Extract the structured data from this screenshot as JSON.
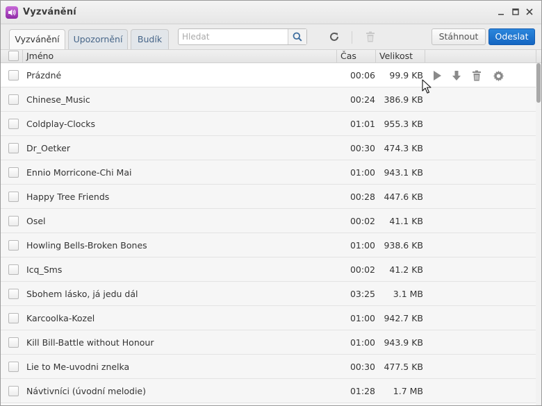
{
  "window": {
    "title": "Vyzvánění",
    "icon": "speaker-icon",
    "controls": [
      "minimize",
      "maximize",
      "close"
    ]
  },
  "tabs": [
    {
      "label": "Vyzvánění",
      "active": true
    },
    {
      "label": "Upozornění",
      "active": false
    },
    {
      "label": "Budík",
      "active": false
    }
  ],
  "search": {
    "placeholder": "Hledat",
    "value": ""
  },
  "toolbar": {
    "download_label": "Stáhnout",
    "send_label": "Odeslat",
    "accent": "#1a72cf"
  },
  "table": {
    "headers": {
      "name": "Jméno",
      "time": "Čas",
      "size": "Velikost"
    },
    "rows": [
      {
        "name": "Prázdné",
        "time": "00:06",
        "size": "99.9 KB"
      },
      {
        "name": "Chinese_Music",
        "time": "00:24",
        "size": "386.9 KB"
      },
      {
        "name": "Coldplay-Clocks",
        "time": "01:01",
        "size": "955.3 KB"
      },
      {
        "name": "Dr_Oetker",
        "time": "00:30",
        "size": "474.3 KB"
      },
      {
        "name": "Ennio Morricone-Chi Mai",
        "time": "01:00",
        "size": "943.1 KB"
      },
      {
        "name": "Happy Tree Friends",
        "time": "00:28",
        "size": "447.6 KB"
      },
      {
        "name": "Osel",
        "time": "00:02",
        "size": "41.1 KB"
      },
      {
        "name": "Howling Bells-Broken Bones",
        "time": "01:00",
        "size": "938.6 KB"
      },
      {
        "name": "Icq_Sms",
        "time": "00:02",
        "size": "41.2 KB"
      },
      {
        "name": "Sbohem lásko, já jedu dál",
        "time": "03:25",
        "size": "3.1 MB"
      },
      {
        "name": "Karcoolka-Kozel",
        "time": "01:00",
        "size": "942.7 KB"
      },
      {
        "name": "Kill Bill-Battle without Honour",
        "time": "01:00",
        "size": "943.9 KB"
      },
      {
        "name": "Lie to Me-uvodni znelka",
        "time": "00:30",
        "size": "477.5 KB"
      },
      {
        "name": "Návtivníci (úvodní melodie)",
        "time": "01:28",
        "size": "1.7 MB"
      }
    ]
  }
}
